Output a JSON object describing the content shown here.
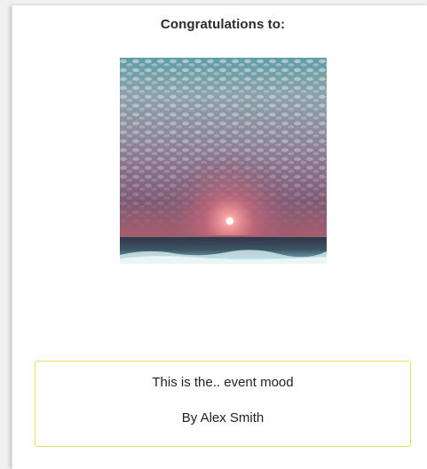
{
  "card": {
    "heading": "Congratulations to:",
    "image": {
      "subject": "sunset over the ocean beneath a cloudy sky"
    },
    "message": {
      "text": "This is the.. event mood",
      "author": "By Alex Smith"
    }
  },
  "colors": {
    "page_background": "#f1f1f1",
    "card_background": "#ffffff",
    "message_border": "#ecdd62",
    "text": "#222222"
  }
}
